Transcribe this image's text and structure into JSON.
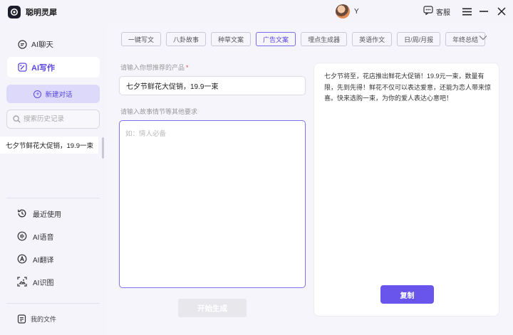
{
  "app": {
    "name": "聪明灵犀"
  },
  "header": {
    "user_name": "Y",
    "service_label": "客服"
  },
  "sidebar": {
    "nav": [
      {
        "label": "AI聊天",
        "icon": "chat-bubble-icon"
      },
      {
        "label": "AI写作",
        "icon": "write-icon"
      }
    ],
    "new_chat_label": "新建对话",
    "search_placeholder": "搜索历史记录",
    "history": [
      "七夕节鲜花大促销，19.9一束"
    ],
    "tools": [
      {
        "label": "最近使用",
        "icon": "history-icon"
      },
      {
        "label": "AI语音",
        "icon": "voice-icon"
      },
      {
        "label": "AI翻译",
        "icon": "translate-icon"
      },
      {
        "label": "AI识图",
        "icon": "image-recognition-icon"
      }
    ],
    "files_label": "我的文件"
  },
  "main": {
    "tabs": [
      "一键写文",
      "八卦故事",
      "种草文案",
      "广告文案",
      "埋点生成器",
      "英语作文",
      "日/周/月报",
      "年终总结"
    ],
    "active_tab": "广告文案",
    "product_label": "请输入你想推荐的产品",
    "required_mark": "*",
    "product_value": "七夕节鲜花大促销，19.9一束",
    "story_label": "请输入故事情节等其他要求",
    "story_placeholder": "如：情人必备",
    "generate_label": "开始生成",
    "output_text": "七夕节将至，花店推出鲜花大促销！19.9元一束，数量有限，先到先得！鲜花不仅可以表达爱意，还能为恋人带来惊喜。快来选购一束，为你的爱人表达心意吧！",
    "copy_label": "复制"
  },
  "colors": {
    "accent": "#5a47e0",
    "accent_button": "#6a55ec",
    "new_chat_bg": "#dcd9fb",
    "disabled_button": "#e7e7ec",
    "required": "#e5484d"
  }
}
